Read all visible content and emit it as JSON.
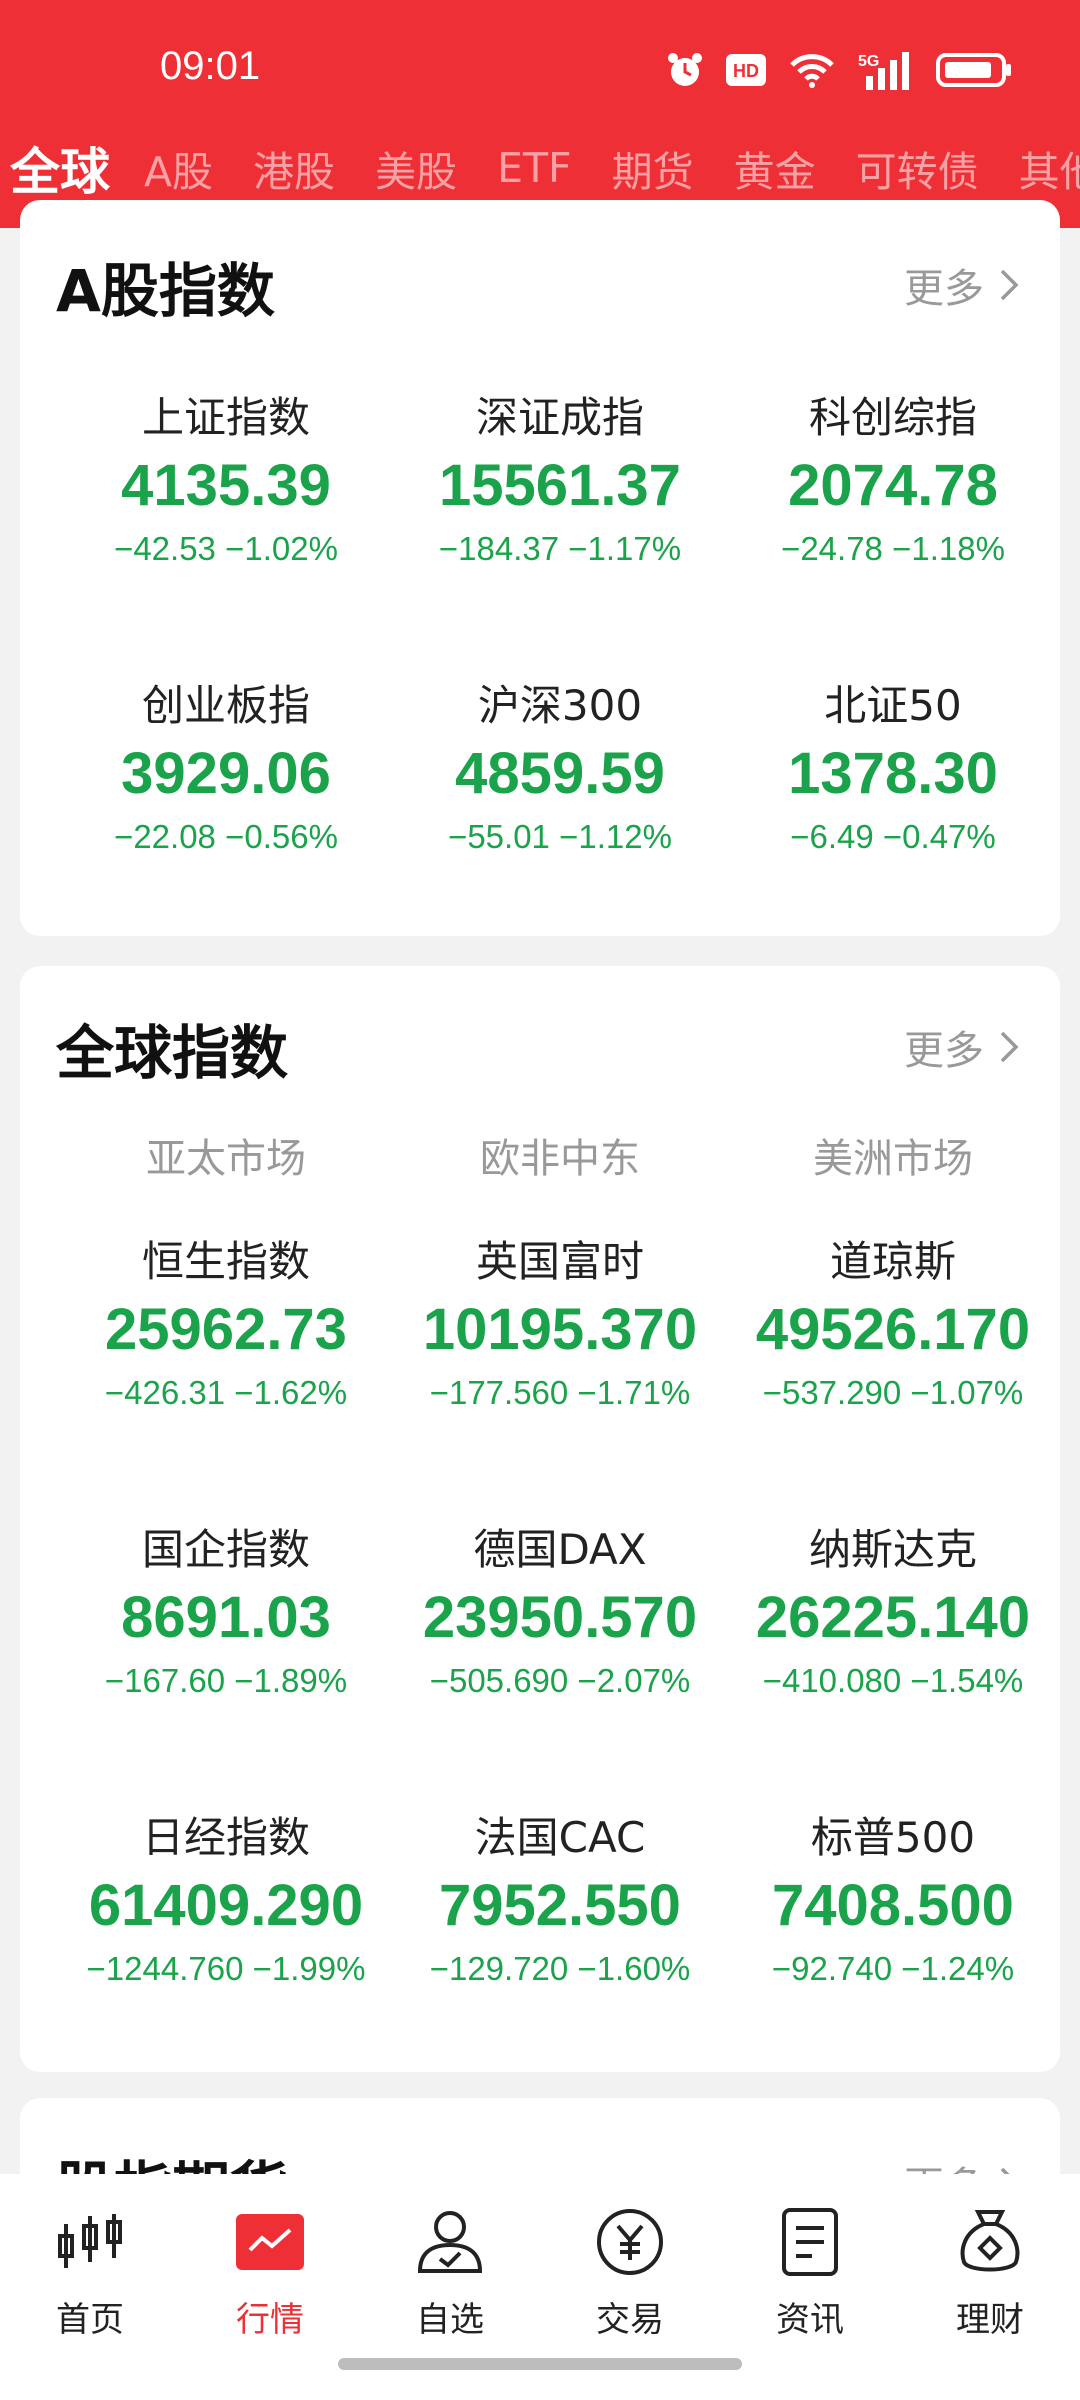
{
  "status_bar": {
    "time": "09:01"
  },
  "market_tabs": [
    "全球",
    "A股",
    "港股",
    "美股",
    "ETF",
    "期货",
    "黄金",
    "可转债",
    "其他"
  ],
  "a_share": {
    "title": "A股指数",
    "more": "更多",
    "indices": [
      {
        "name": "上证指数",
        "value": "4135.39",
        "change": "−42.53 −1.02%"
      },
      {
        "name": "深证成指",
        "value": "15561.37",
        "change": "−184.37 −1.17%"
      },
      {
        "name": "科创综指",
        "value": "2074.78",
        "change": "−24.78 −1.18%"
      },
      {
        "name": "创业板指",
        "value": "3929.06",
        "change": "−22.08 −0.56%"
      },
      {
        "name": "沪深300",
        "value": "4859.59",
        "change": "−55.01 −1.12%"
      },
      {
        "name": "北证50",
        "value": "1378.30",
        "change": "−6.49 −0.47%"
      }
    ]
  },
  "global": {
    "title": "全球指数",
    "more": "更多",
    "regions": [
      "亚太市场",
      "欧非中东",
      "美洲市场"
    ],
    "indices": [
      {
        "name": "恒生指数",
        "value": "25962.73",
        "change": "−426.31 −1.62%"
      },
      {
        "name": "英国富时",
        "value": "10195.370",
        "change": "−177.560 −1.71%"
      },
      {
        "name": "道琼斯",
        "value": "49526.170",
        "change": "−537.290 −1.07%"
      },
      {
        "name": "国企指数",
        "value": "8691.03",
        "change": "−167.60 −1.89%"
      },
      {
        "name": "德国DAX",
        "value": "23950.570",
        "change": "−505.690 −2.07%"
      },
      {
        "name": "纳斯达克",
        "value": "26225.140",
        "change": "−410.080 −1.54%"
      },
      {
        "name": "日经指数",
        "value": "61409.290",
        "change": "−1244.760 −1.99%"
      },
      {
        "name": "法国CAC",
        "value": "7952.550",
        "change": "−129.720 −1.60%"
      },
      {
        "name": "标普500",
        "value": "7408.500",
        "change": "−92.740 −1.24%"
      }
    ]
  },
  "futures": {
    "title": "股指期货",
    "more": "更多"
  },
  "bottom_nav": [
    {
      "label": "首页",
      "icon": "candlestick-icon"
    },
    {
      "label": "行情",
      "icon": "market-chart-icon"
    },
    {
      "label": "自选",
      "icon": "user-check-icon"
    },
    {
      "label": "交易",
      "icon": "yuan-circle-icon"
    },
    {
      "label": "资讯",
      "icon": "news-doc-icon"
    },
    {
      "label": "理财",
      "icon": "money-bag-icon"
    }
  ],
  "colors": {
    "brand_red": "#ee3036",
    "down_green": "#1aa34a"
  }
}
